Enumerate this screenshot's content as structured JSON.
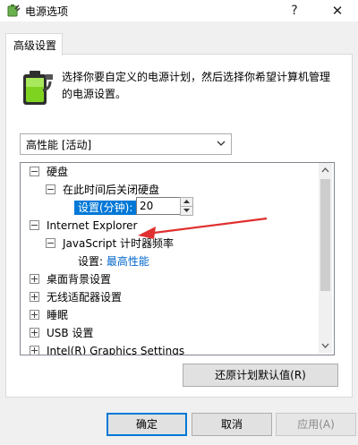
{
  "window": {
    "title": "电源选项",
    "help_glyph": "?",
    "close_glyph": "✕"
  },
  "tab": {
    "label": "高级设置"
  },
  "description": "选择你要自定义的电源计划，然后选择你希望计算机管理的电源设置。",
  "plan_selector": {
    "selected": "高性能 [活动]"
  },
  "tree": {
    "items": [
      {
        "label": "硬盘",
        "state": "expanded"
      },
      {
        "label": "在此时间后关闭硬盘",
        "state": "expanded"
      },
      {
        "label": "设置(分钟):",
        "value": "20"
      },
      {
        "label": "Internet Explorer",
        "state": "expanded"
      },
      {
        "label": "JavaScript 计时器频率",
        "state": "expanded"
      },
      {
        "label": "设置:",
        "value": "最高性能"
      },
      {
        "label": "桌面背景设置",
        "state": "collapsed"
      },
      {
        "label": "无线适配器设置",
        "state": "collapsed"
      },
      {
        "label": "睡眠",
        "state": "collapsed"
      },
      {
        "label": "USB 设置",
        "state": "collapsed"
      },
      {
        "label": "Intel(R) Graphics Settings",
        "state": "collapsed"
      }
    ]
  },
  "buttons": {
    "restore": "还原计划默认值(R)",
    "ok": "确定",
    "cancel": "取消",
    "apply": "应用(A)"
  },
  "colors": {
    "accent": "#0078d7",
    "link": "#0066cc",
    "annotation_arrow": "#e03030"
  },
  "icons": {
    "window": "power-options-icon",
    "battery": "battery-plug-icon"
  }
}
